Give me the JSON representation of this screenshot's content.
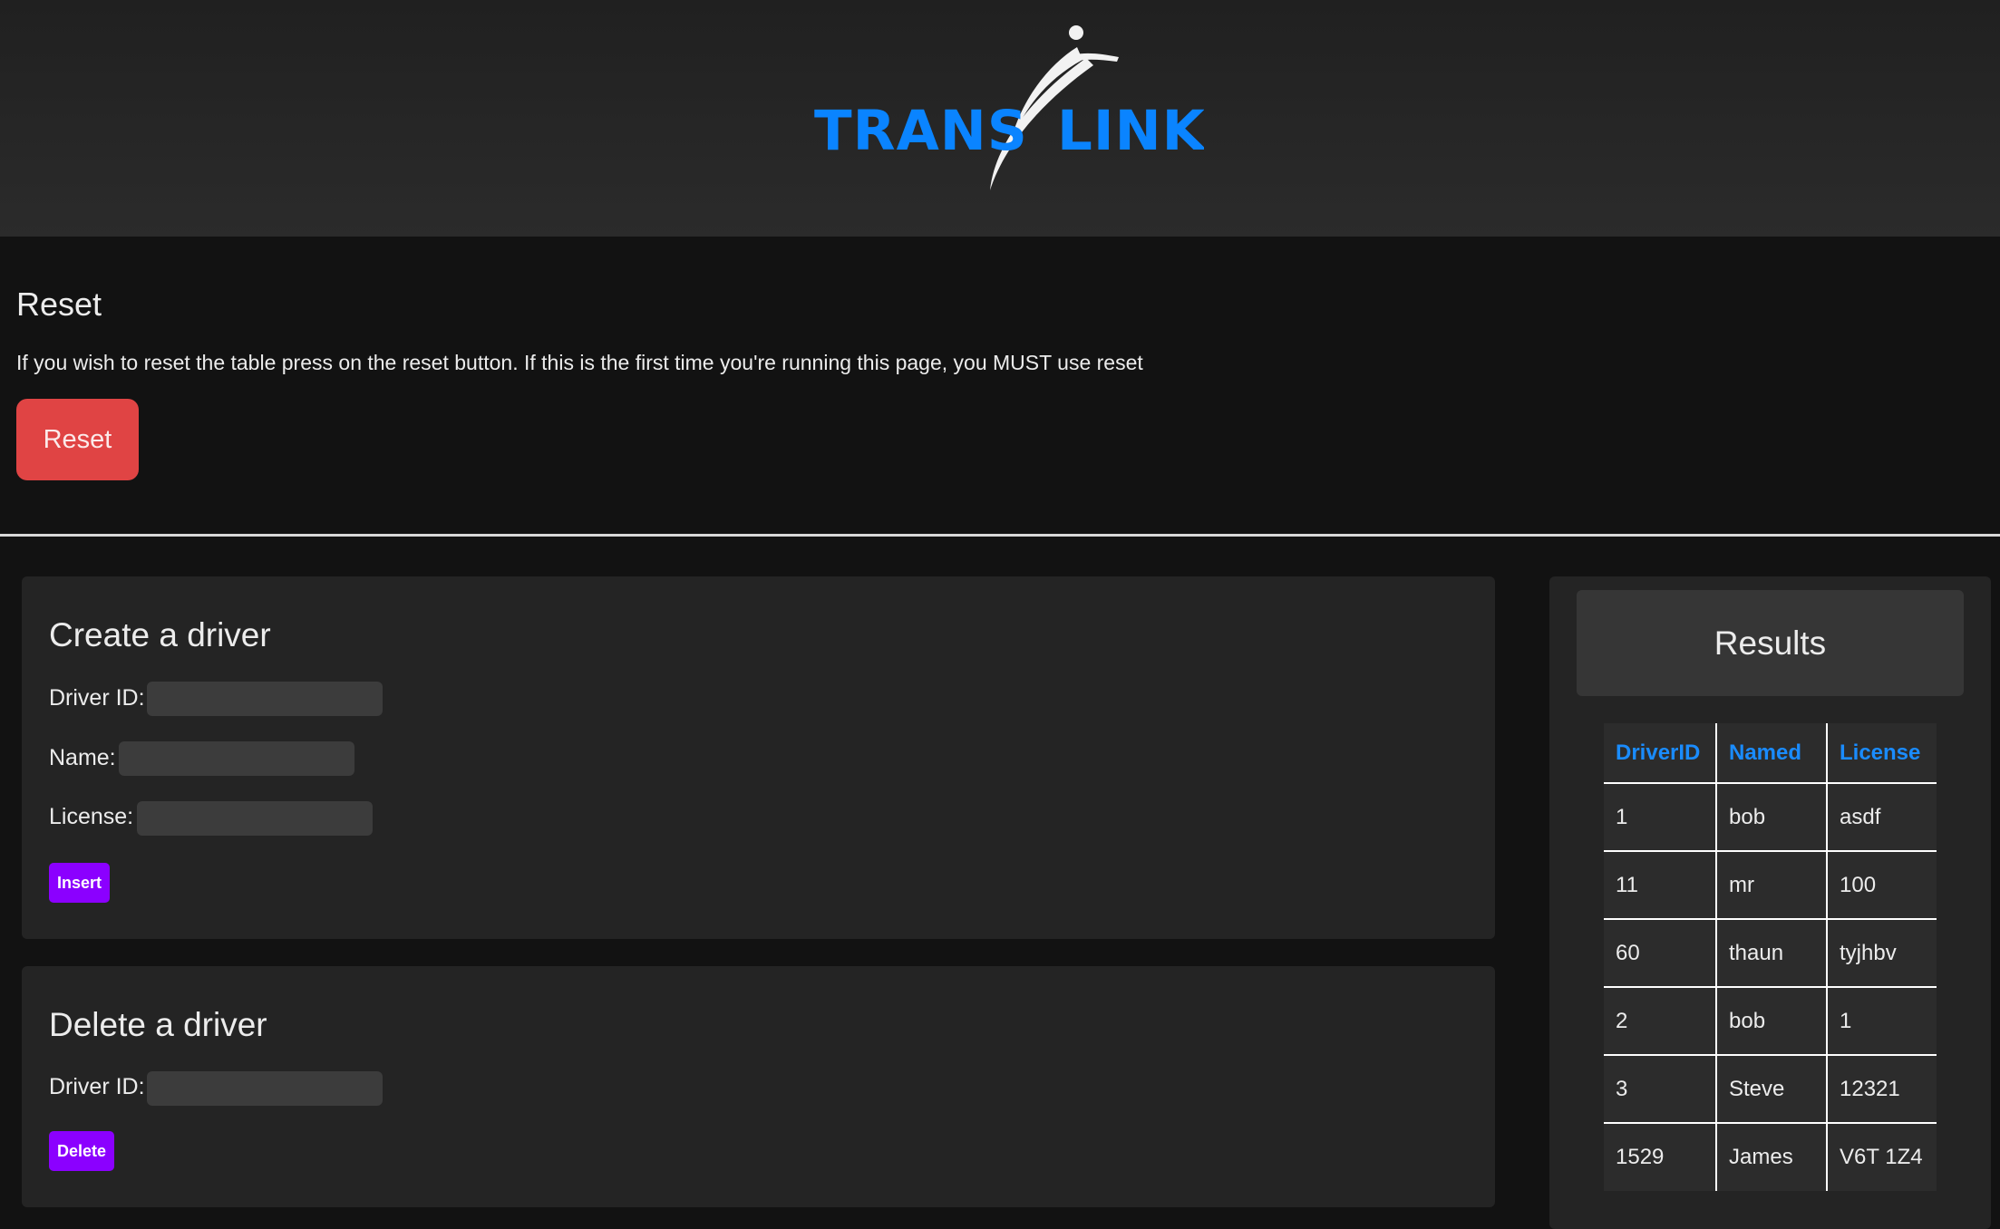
{
  "header": {
    "logo_left": "TRANS",
    "logo_right": "LINK"
  },
  "reset": {
    "title": "Reset",
    "description": "If you wish to reset the table press on the reset button. If this is the first time you're running this page, you MUST use reset",
    "button_label": "Reset"
  },
  "create": {
    "title": "Create a driver",
    "fields": [
      {
        "label": "Driver ID:",
        "value": ""
      },
      {
        "label": "Name:",
        "value": ""
      },
      {
        "label": "License:",
        "value": ""
      }
    ],
    "button_label": "Insert"
  },
  "delete": {
    "title": "Delete a driver",
    "fields": [
      {
        "label": "Driver ID:",
        "value": ""
      }
    ],
    "button_label": "Delete"
  },
  "results": {
    "title": "Results",
    "columns": [
      "DriverID",
      "Named",
      "License"
    ],
    "rows": [
      [
        "1",
        "bob",
        "asdf"
      ],
      [
        "11",
        "mr",
        "100"
      ],
      [
        "60",
        "thaun",
        "tyjhbv"
      ],
      [
        "2",
        "bob",
        "1"
      ],
      [
        "3",
        "Steve",
        "12321"
      ],
      [
        "1529",
        "James",
        "V6T 1Z4"
      ]
    ]
  },
  "colors": {
    "logo_blue": "#0a84ff",
    "reset_red": "#e04444",
    "action_purple": "#8b00ff",
    "table_header_blue": "#1a8cff"
  }
}
